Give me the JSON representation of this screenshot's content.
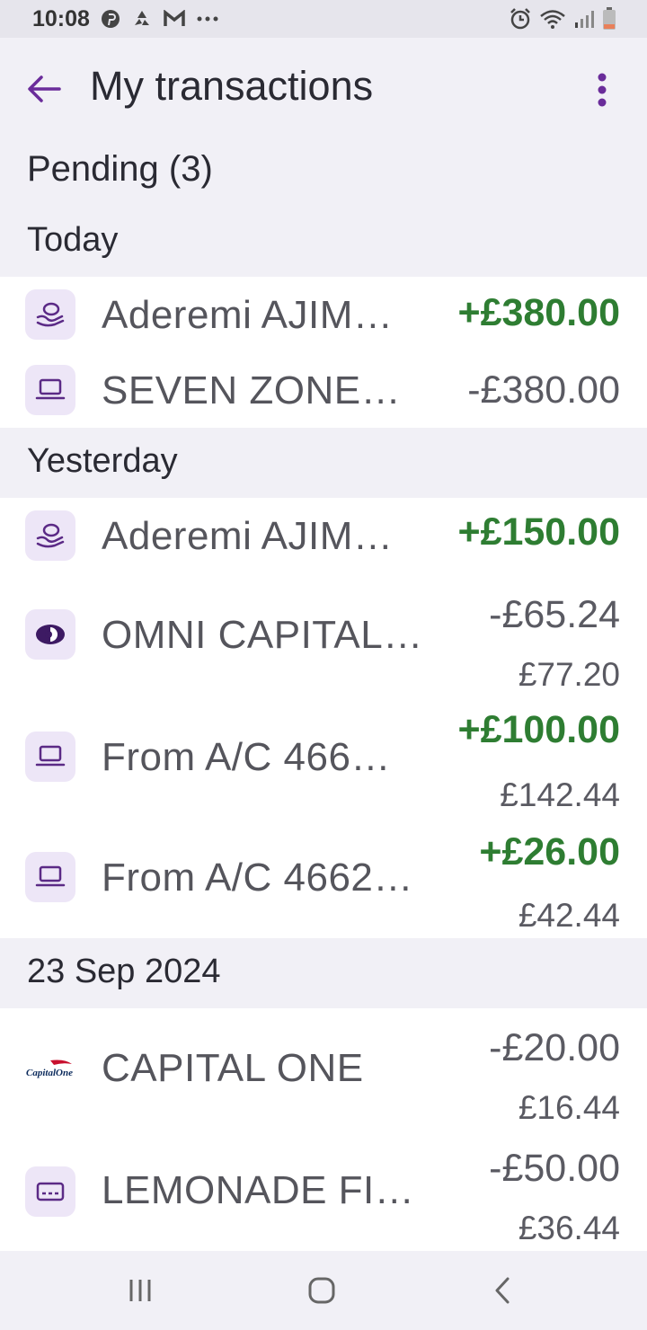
{
  "status": {
    "time": "10:08"
  },
  "header": {
    "title": "My transactions"
  },
  "pending": {
    "label": "Pending (3)"
  },
  "sections": [
    {
      "label": "Today",
      "items": [
        {
          "name": "Aderemi AJIM…",
          "amount": "+£380.00",
          "icon": "hand-coins-icon"
        },
        {
          "name": "SEVEN ZONE…",
          "amount": "-£380.00",
          "icon": "laptop-icon"
        }
      ]
    },
    {
      "label": "Yesterday",
      "items": [
        {
          "name": "Aderemi AJIM…",
          "amount": "+£150.00",
          "icon": "hand-coins-icon"
        },
        {
          "name": "OMNI CAPITAL…",
          "amount": "-£65.24",
          "balance": "£77.20",
          "icon": "omni-capital-logo"
        },
        {
          "name": "From A/C 466…",
          "amount": "+£100.00",
          "balance": "£142.44",
          "icon": "laptop-icon"
        },
        {
          "name": "From A/C 4662…",
          "amount": "+£26.00",
          "balance": "£42.44",
          "icon": "laptop-icon"
        }
      ]
    },
    {
      "label": "23 Sep 2024",
      "items": [
        {
          "name": "CAPITAL ONE",
          "amount": "-£20.00",
          "balance": "£16.44",
          "icon": "capital-one-logo",
          "logo_text": "CapitalOne"
        },
        {
          "name": "LEMONADE FI…",
          "amount": "-£50.00",
          "balance": "£36.44",
          "icon": "card-icon"
        }
      ]
    }
  ],
  "colors": {
    "accent": "#6a2c9a",
    "credit": "#2e7d32",
    "icon_bg": "#ede6f7",
    "section_bg": "#f1f0f6"
  }
}
